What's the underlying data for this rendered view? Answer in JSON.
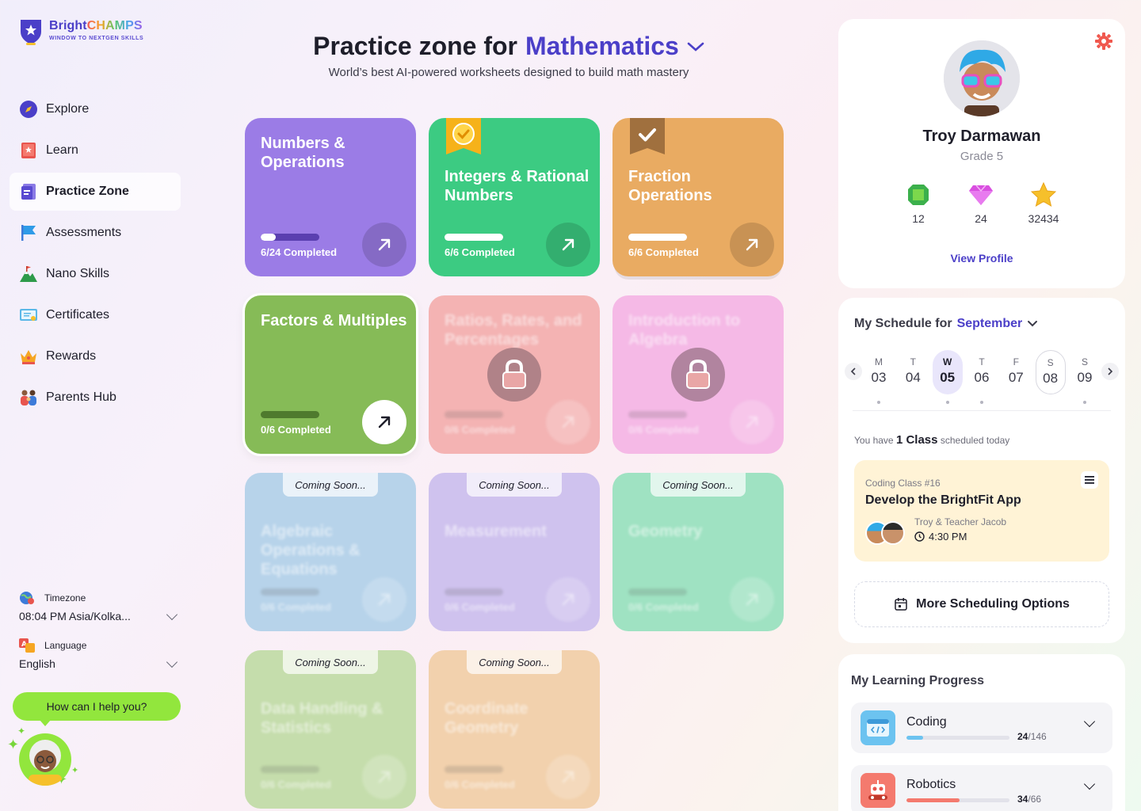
{
  "brand": {
    "name_a": "Bright",
    "name_b": "CHAMPS",
    "tagline": "WINDOW TO NEXTGEN SKILLS"
  },
  "sidebar": {
    "items": [
      {
        "label": "Explore",
        "icon": "compass-icon",
        "active": false
      },
      {
        "label": "Learn",
        "icon": "book-icon",
        "active": false
      },
      {
        "label": "Practice Zone",
        "icon": "worksheet-icon",
        "active": true
      },
      {
        "label": "Assessments",
        "icon": "flag-icon",
        "active": false
      },
      {
        "label": "Nano Skills",
        "icon": "mountain-icon",
        "active": false
      },
      {
        "label": "Certificates",
        "icon": "certificate-icon",
        "active": false
      },
      {
        "label": "Rewards",
        "icon": "crown-icon",
        "active": false
      },
      {
        "label": "Parents Hub",
        "icon": "family-icon",
        "active": false
      }
    ],
    "timezone": {
      "label": "Timezone",
      "value": "08:04 PM Asia/Kolka..."
    },
    "language": {
      "label": "Language",
      "value": "English"
    },
    "help": "How can I help you?"
  },
  "header": {
    "title_prefix": "Practice zone for",
    "subject": "Mathematics",
    "subtitle": "World’s best AI-powered worksheets designed to build math mastery"
  },
  "cards": [
    {
      "title": "Numbers & Operations",
      "status": "6/24 Completed",
      "progress": 0.25,
      "state": "open",
      "color": "#9b7ce6",
      "badge": ""
    },
    {
      "title": "Integers & Rational Numbers",
      "status": "6/6 Completed",
      "progress": 1.0,
      "state": "open",
      "color": "#3ccb82",
      "badge": "medal"
    },
    {
      "title": "Fraction Operations",
      "status": "6/6 Completed",
      "progress": 1.0,
      "state": "open",
      "color": "#e9ab62",
      "badge": "check"
    },
    {
      "title": "Factors & Multiples",
      "status": "0/6 Completed",
      "progress": 0.0,
      "state": "current",
      "color": "#86bb57",
      "badge": ""
    },
    {
      "title": "Ratios, Rates, and Percentages",
      "status": "0/6 Completed",
      "progress": 0.0,
      "state": "locked",
      "color": "#f4b3b3",
      "badge": ""
    },
    {
      "title": "Introduction to Algebra",
      "status": "0/6 Completed",
      "progress": 0.0,
      "state": "locked",
      "color": "#f5b9e6",
      "badge": ""
    },
    {
      "title": "Algebraic Operations & Equations",
      "status": "0/6 Completed",
      "progress": 0.0,
      "state": "soon",
      "color": "#b7d3ea",
      "badge": ""
    },
    {
      "title": "Measurement",
      "status": "0/6 Completed",
      "progress": 0.0,
      "state": "soon",
      "color": "#cfc2ee",
      "badge": ""
    },
    {
      "title": "Geometry",
      "status": "0/6 Completed",
      "progress": 0.0,
      "state": "soon",
      "color": "#9fe2c2",
      "badge": ""
    },
    {
      "title": "Data Handling & Statistics",
      "status": "0/6 Completed",
      "progress": 0.0,
      "state": "soon",
      "color": "#c5ddac",
      "badge": ""
    },
    {
      "title": "Coordinate Geometry",
      "status": "0/6 Completed",
      "progress": 0.0,
      "state": "soon",
      "color": "#f2d1ad",
      "badge": ""
    }
  ],
  "coming_soon_label": "Coming Soon...",
  "profile": {
    "name": "Troy Darmawan",
    "grade": "Grade 5",
    "stats": [
      {
        "icon": "emerald-icon",
        "value": "12"
      },
      {
        "icon": "diamond-icon",
        "value": "24"
      },
      {
        "icon": "star-icon",
        "value": "32434"
      }
    ],
    "view_profile": "View Profile"
  },
  "schedule": {
    "title": "My Schedule for",
    "month": "September",
    "days": [
      {
        "name": "M",
        "date": "03",
        "dot": true
      },
      {
        "name": "T",
        "date": "04",
        "dot": false
      },
      {
        "name": "W",
        "date": "05",
        "dot": true
      },
      {
        "name": "T",
        "date": "06",
        "dot": true
      },
      {
        "name": "F",
        "date": "07",
        "dot": false
      },
      {
        "name": "S",
        "date": "08",
        "dot": false
      },
      {
        "name": "S",
        "date": "09",
        "dot": true
      }
    ],
    "note_a": "You have",
    "note_count": "1 Class",
    "note_b": "scheduled today",
    "class": {
      "number": "Coding Class #16",
      "title": "Develop the BrightFit App",
      "who": "Troy & Teacher Jacob",
      "time": "4:30 PM"
    },
    "more_options": "More Scheduling Options"
  },
  "learning_progress": {
    "title": "My Learning Progress",
    "items": [
      {
        "name": "Coding",
        "done": "24",
        "total": "/146",
        "fraction": 0.164,
        "color": "#6cc3f0",
        "icon": "code-window-icon"
      },
      {
        "name": "Robotics",
        "done": "34",
        "total": "/66",
        "fraction": 0.515,
        "color": "#f47a6e",
        "icon": "robot-icon"
      }
    ]
  }
}
